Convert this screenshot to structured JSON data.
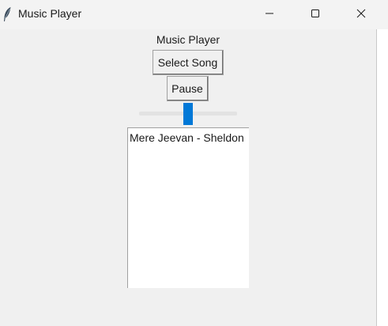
{
  "window": {
    "title": "Music Player",
    "app_icon": "feather-icon",
    "controls": {
      "minimize_icon": "minimize-icon",
      "maximize_icon": "maximize-icon",
      "close_icon": "close-icon"
    }
  },
  "main": {
    "heading": "Music Player",
    "select_song_label": "Select Song",
    "pause_label": "Pause",
    "volume_slider": {
      "value": 0.5,
      "accent": "#0078d7"
    },
    "playlist": {
      "items": [
        "Mere Jeevan - Sheldon"
      ]
    }
  }
}
